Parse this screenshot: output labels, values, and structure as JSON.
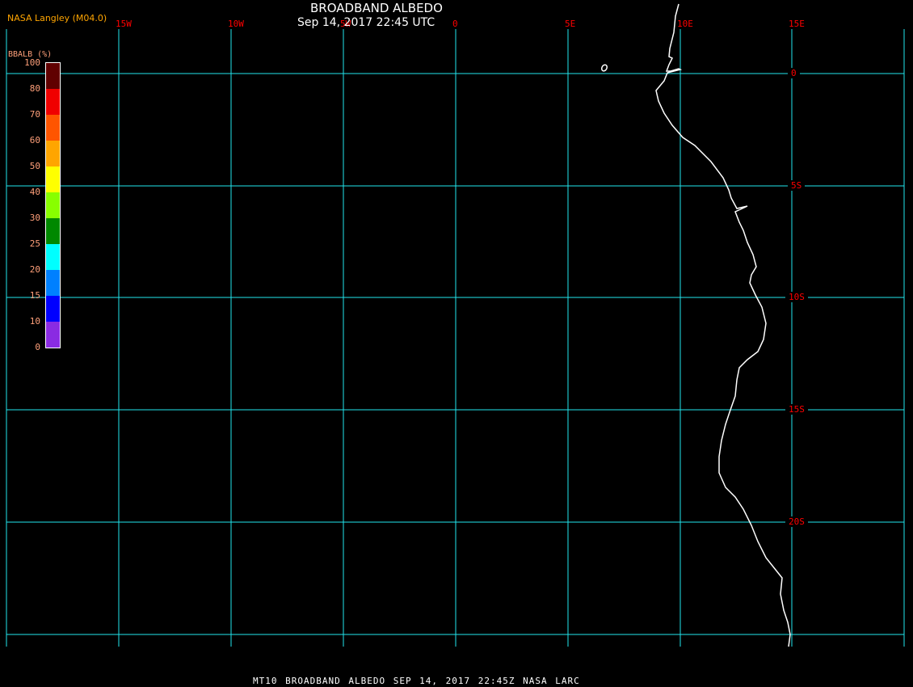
{
  "header": {
    "title": "BROADBAND ALBEDO",
    "subtitle": "Sep 14, 2017 22:45 UTC",
    "brand": "NASA Langley (M04.0)"
  },
  "colorbar": {
    "title": "BBALB (%)",
    "ticks": [
      "100",
      "80",
      "70",
      "60",
      "50",
      "40",
      "30",
      "25",
      "20",
      "15",
      "10",
      "0"
    ],
    "colors": [
      "#600000",
      "#f00000",
      "#ff5500",
      "#ffa500",
      "#ffff00",
      "#88ff00",
      "#008800",
      "#00ffff",
      "#0080ff",
      "#0000ff",
      "#8a2be2"
    ]
  },
  "grid": {
    "line_color": "#22e6ee",
    "label_color": "#ff0000",
    "lon_labels": [
      "15W",
      "10W",
      "5W",
      "0",
      "5E",
      "10E",
      "15E"
    ],
    "lat_labels": [
      "0",
      "5S",
      "10S",
      "15S",
      "20S"
    ]
  },
  "coastline_color": "#ffffff",
  "footer": {
    "caption": "MT10  BROADBAND ALBEDO   SEP 14, 2017 22:45Z   NASA LARC"
  }
}
